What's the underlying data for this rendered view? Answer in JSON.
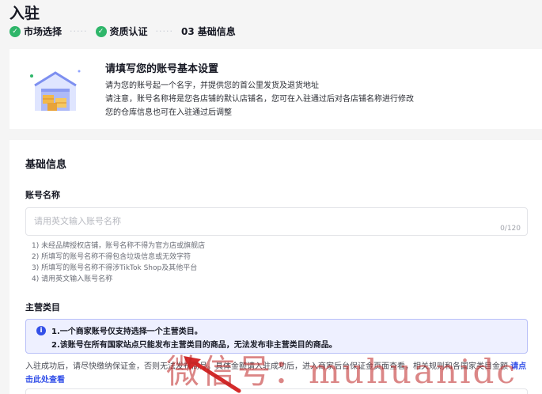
{
  "page": {
    "title": "入驻"
  },
  "steps": [
    {
      "label": "市场选择",
      "state": "done"
    },
    {
      "label": "资质认证",
      "state": "done"
    },
    {
      "number": "03",
      "label": "基础信息",
      "state": "current"
    }
  ],
  "notice": {
    "title": "请填写您的账号基本设置",
    "lines": [
      "请为您的账号起一个名字，并提供您的首公里发货及退货地址",
      "请注意，账号名称将是您各店铺的默认店铺名，您可在入驻通过后对各店铺名称进行修改",
      "您的仓库信息也可在入驻通过后调整"
    ]
  },
  "form": {
    "section_title": "基础信息",
    "account_name": {
      "label": "账号名称",
      "placeholder": "请用英文输入账号名称",
      "counter": "0/120",
      "hints": [
        "1) 未经品牌授权店铺，账号名称不得为官方店或旗舰店",
        "2) 所填写的账号名称不得包含垃圾信息或无效字符",
        "3) 所填写的账号名称不得涉TikTok Shop及其他平台",
        "4) 请用英文输入账号名称"
      ]
    },
    "main_category": {
      "label": "主营类目",
      "info_lines": [
        "1.一个商家账号仅支持选择一个主营类目。",
        "2.该账号在所有国家站点只能发布主营类目的商品，无法发布非主营类目的商品。"
      ],
      "description": "入驻成功后，请尽快缴纳保证金，否则无法发布商品。具体金额请入驻成功后，进入商家后台保证金页面查看，相关规则和各国家类目金额",
      "link_text": "请点击此处查看"
    }
  },
  "watermark": {
    "text": "微信号：muhuanidc"
  },
  "colors": {
    "success": "#2fb66a",
    "primary": "#3350e8",
    "watermark": "#be2323"
  }
}
